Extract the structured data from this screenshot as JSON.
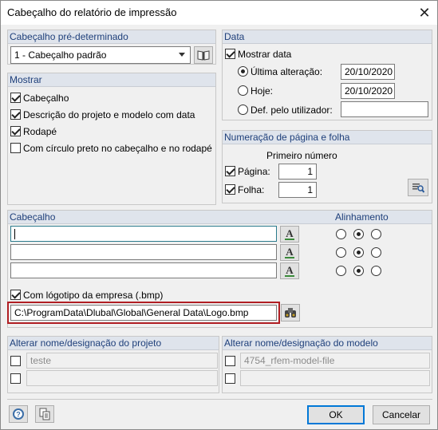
{
  "window": {
    "title": "Cabeçalho do relatório de impressão"
  },
  "predefined": {
    "title": "Cabeçalho pré-determinado",
    "selected": "1 - Cabeçalho padrão"
  },
  "show": {
    "title": "Mostrar",
    "items": [
      {
        "label": "Cabeçalho",
        "checked": true
      },
      {
        "label": "Descrição do projeto e modelo com data",
        "checked": true
      },
      {
        "label": "Rodapé",
        "checked": true
      },
      {
        "label": "Com círculo preto no cabeçalho e no rodapé",
        "checked": false
      }
    ]
  },
  "date": {
    "title": "Data",
    "show_label": "Mostrar data",
    "options": [
      {
        "label": "Última alteração:",
        "value": "20/10/2020",
        "selected": true
      },
      {
        "label": "Hoje:",
        "value": "20/10/2020",
        "selected": false
      },
      {
        "label": "Def. pelo utilizador:",
        "value": "",
        "selected": false
      }
    ]
  },
  "numbering": {
    "title": "Numeração de página e folha",
    "first_number_label": "Primeiro número",
    "page_label": "Página:",
    "page_value": "1",
    "sheet_label": "Folha:",
    "sheet_value": "1"
  },
  "header": {
    "title": "Cabeçalho",
    "lines": [
      "",
      "",
      ""
    ],
    "alignment_title": "Alinhamento",
    "alignment_selected": [
      1,
      1,
      1
    ],
    "logo_label": "Com lógotipo da empresa (.bmp)",
    "logo_path": "C:\\ProgramData\\Dlubal\\Global\\General Data\\Logo.bmp"
  },
  "project_rename": {
    "title": "Alterar nome/designação do projeto",
    "name": "teste",
    "designation": ""
  },
  "model_rename": {
    "title": "Alterar nome/designação do modelo",
    "name": "4754_rfem-model-file",
    "designation": ""
  },
  "buttons": {
    "ok": "OK",
    "cancel": "Cancelar"
  },
  "colors": {
    "accent": "#0078d7",
    "highlight": "#b01e23",
    "group_header": "#dfe4ec"
  }
}
